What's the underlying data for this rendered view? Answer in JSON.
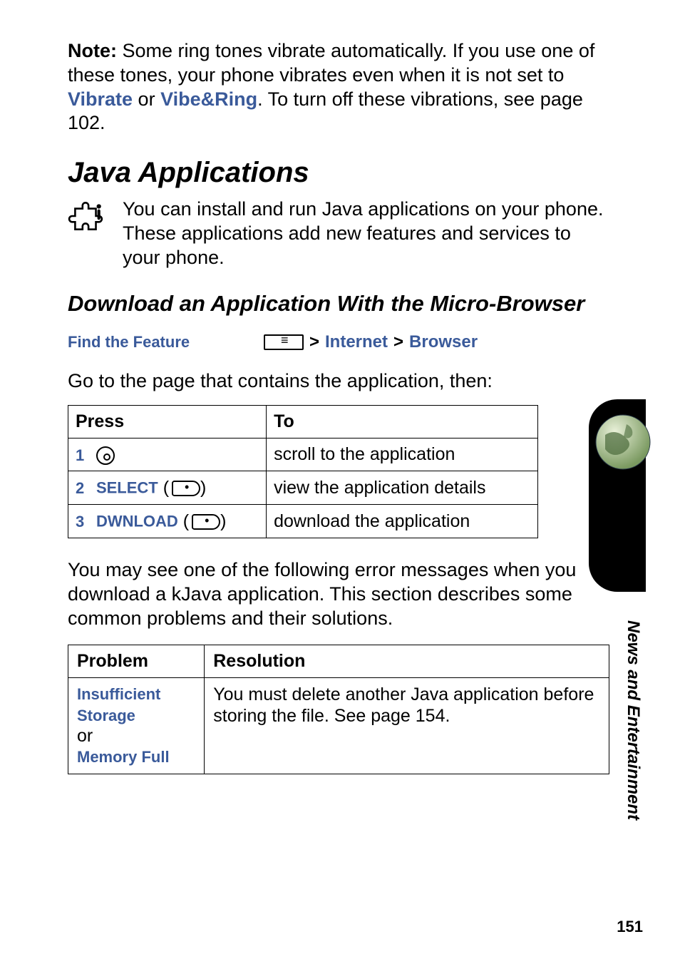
{
  "note": {
    "prefix": "Note:",
    "body_a": " Some ring tones vibrate automatically. If you use one of these tones, your phone vibrates even when it is not set to ",
    "vibrate": "Vibrate",
    "or": " or ",
    "vibe_ring": "Vibe&Ring",
    "body_b": ". To turn off these vibrations, see page 102."
  },
  "h1": "Java Applications",
  "intro": "You can install and run Java applications on your phone. These applications add new features and services to your phone.",
  "h2": "Download an Application With the Micro-Browser",
  "find": {
    "label": "Find the Feature",
    "path_a": "Internet",
    "path_b": "Browser"
  },
  "goto": "Go to the page that contains the application, then:",
  "steps_header": {
    "press": "Press",
    "to": "To"
  },
  "steps": [
    {
      "num": "1",
      "action": "",
      "to": "scroll to the application"
    },
    {
      "num": "2",
      "action": "SELECT",
      "to": "view the application details"
    },
    {
      "num": "3",
      "action": "DWNLOAD",
      "to": "download the application"
    }
  ],
  "error_para": "You may see one of the following error messages when you download a kJava application. This section describes some common problems and their solutions.",
  "problems_header": {
    "problem": "Problem",
    "resolution": "Resolution"
  },
  "problems": [
    {
      "label_a": "Insufficient Storage",
      "or": " or",
      "label_b": "Memory Full",
      "resolution": "You must delete another Java application before storing the file. See page 154."
    }
  ],
  "side_label": "News and Entertainment",
  "page_num": "151",
  "icons": {
    "puzzle": "puzzle-icon",
    "menu_key": "menu-key-icon",
    "nav_circle": "nav-circle-icon",
    "softkey": "softkey-icon",
    "globe": "globe-icon"
  }
}
